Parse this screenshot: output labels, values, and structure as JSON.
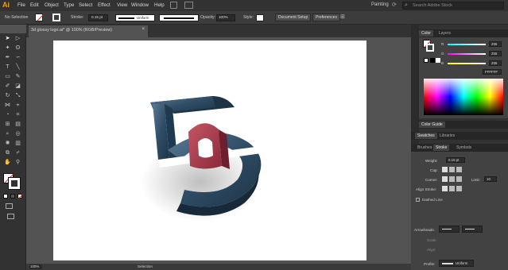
{
  "app": {
    "logo": "Ai",
    "workspace": "Painting",
    "search_placeholder": "Search Adobe Stock"
  },
  "menu": [
    "File",
    "Edit",
    "Object",
    "Type",
    "Select",
    "Effect",
    "View",
    "Window",
    "Help"
  ],
  "control": {
    "selection": "No Selection",
    "stroke_label": "Stroke:",
    "stroke_value": "0.15 pt",
    "profile": "Uniform",
    "opacity_label": "Opacity:",
    "opacity_value": "100%",
    "style_label": "Style:",
    "doc_setup": "Document Setup",
    "preferences": "Preferences"
  },
  "document": {
    "tab_title": "3d glossy logo.ai* @ 100% (RGB/Preview)",
    "close": "×"
  },
  "status": {
    "zoom": "100%",
    "tool": "Selection"
  },
  "color_panel": {
    "tabs": [
      "Color",
      "Layers"
    ],
    "r": {
      "label": "R",
      "value": "255"
    },
    "g": {
      "label": "G",
      "value": "255"
    },
    "b": {
      "label": "B",
      "value": "255"
    },
    "hex": "FFFFFF"
  },
  "color_guide": {
    "title": "Color Guide"
  },
  "swatches": {
    "tabs": [
      "Swatches",
      "Libraries"
    ]
  },
  "stroke_panel": {
    "tabs": [
      "Brushes",
      "Stroke",
      "Symbols"
    ],
    "weight_label": "Weight:",
    "weight_value": "0.15 pt",
    "cap_label": "Cap:",
    "corner_label": "Corner:",
    "limit_label": "Limit:",
    "limit_value": "10",
    "align_label": "Align Stroke:",
    "dashed_label": "Dashed Line",
    "arrowheads_label": "Arrowheads:",
    "scale_label": "Scale:",
    "align2_label": "Align:",
    "profile_label": "Profile:",
    "profile_value": "Uniform"
  },
  "colors": {
    "accent": "#ff9a00",
    "logo_blue": "#2f4d66",
    "logo_red": "#a8384a"
  }
}
